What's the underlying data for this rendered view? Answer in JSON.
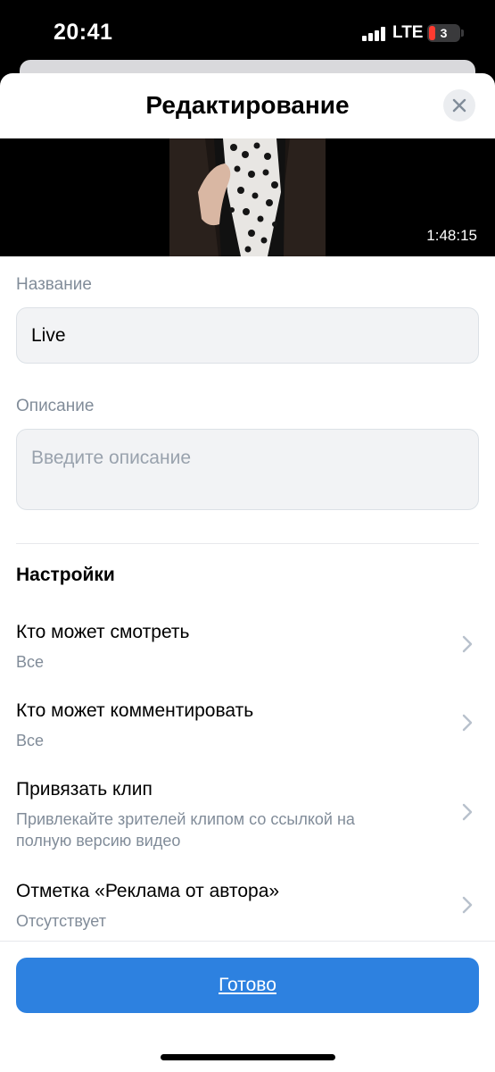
{
  "status_bar": {
    "time": "20:41",
    "network": "LTE",
    "battery": "3"
  },
  "header": {
    "title": "Редактирование"
  },
  "video": {
    "duration": "1:48:15"
  },
  "form": {
    "name_label": "Название",
    "name_value": "Live",
    "description_label": "Описание",
    "description_placeholder": "Введите описание"
  },
  "settings": {
    "title": "Настройки",
    "items": [
      {
        "label": "Кто может смотреть",
        "value": "Все"
      },
      {
        "label": "Кто может комментировать",
        "value": "Все"
      },
      {
        "label": "Привязать клип",
        "value": "Привлекайте зрителей клипом со ссылкой на полную версию видео"
      },
      {
        "label": "Отметка «Реклама от автора»",
        "value": "Отсутствует"
      }
    ]
  },
  "done_button": {
    "label": "Готово"
  },
  "colors": {
    "accent": "#2d81e0",
    "secondary_text": "#818c99",
    "field_bg": "#f2f3f5"
  }
}
